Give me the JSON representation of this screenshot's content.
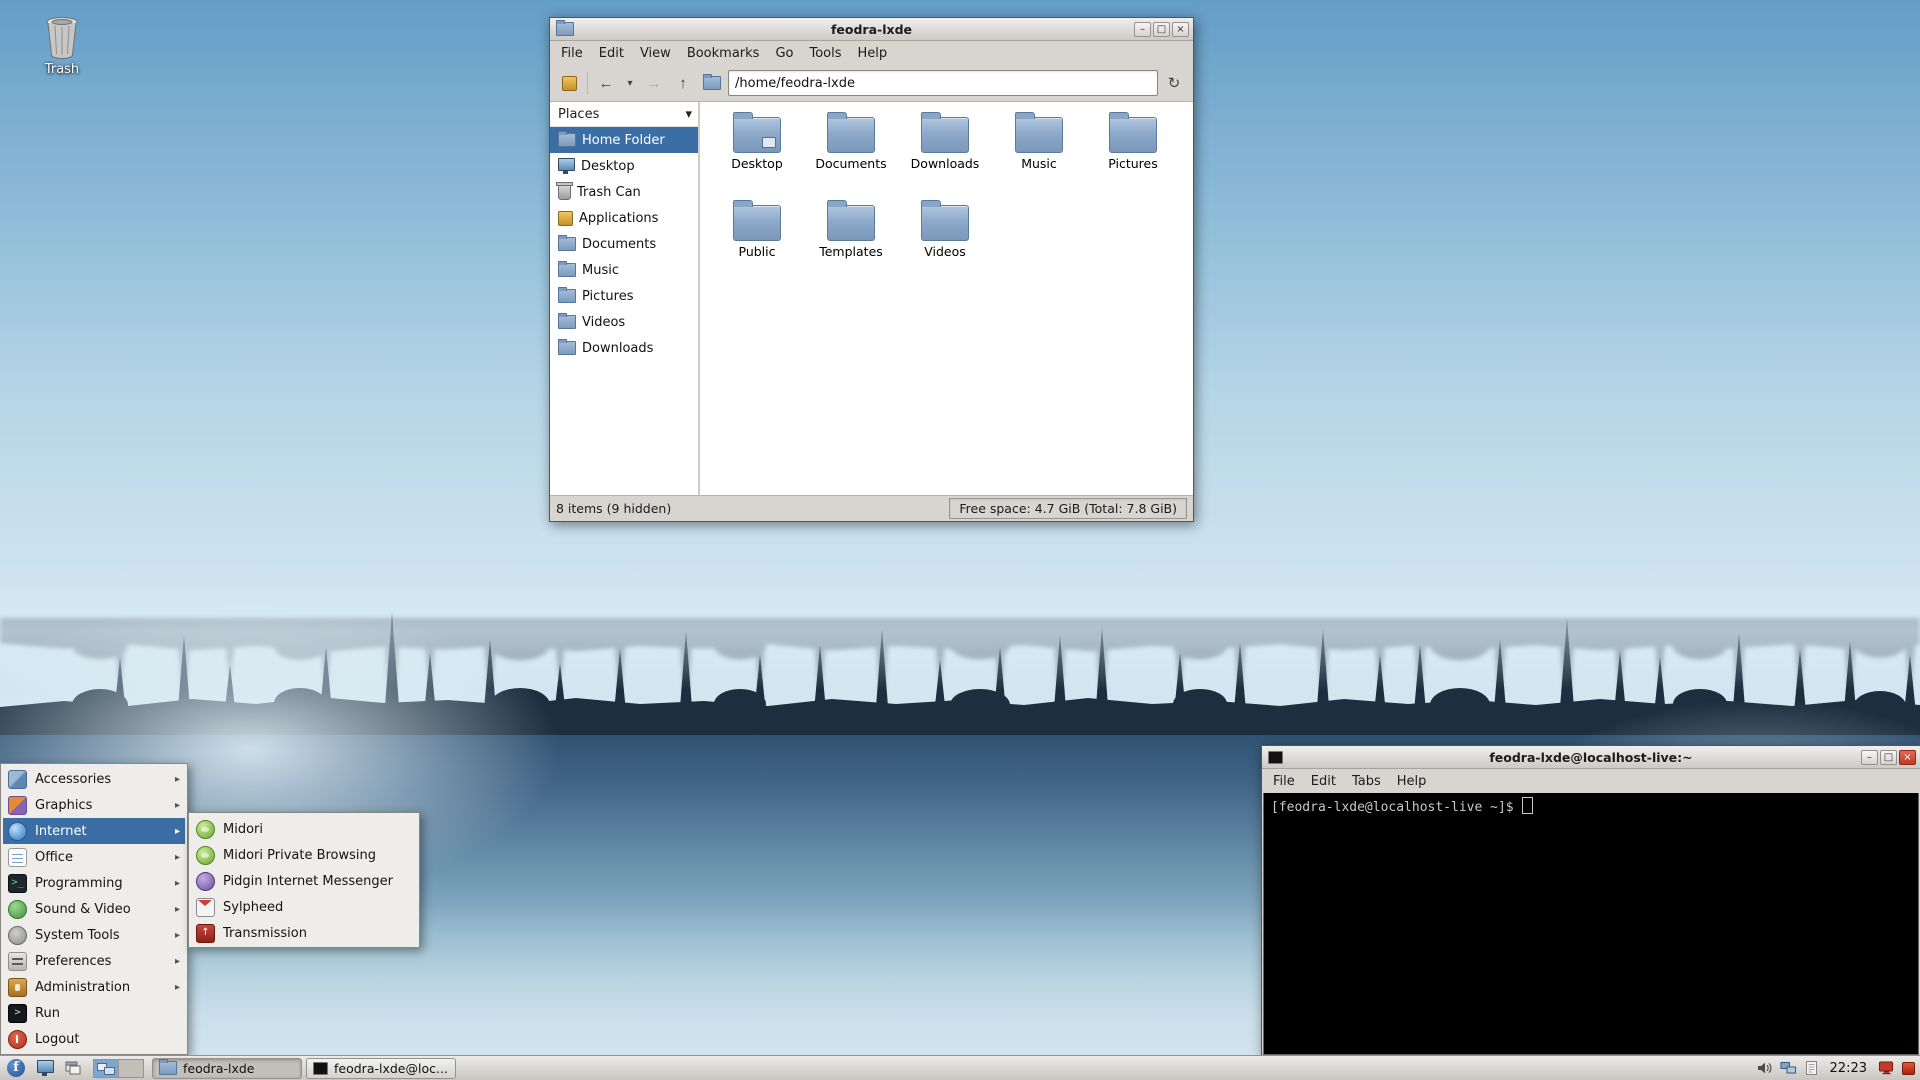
{
  "desktop": {
    "trash_label": "Trash"
  },
  "icons": {
    "back": "←",
    "forward": "→",
    "up": "↑",
    "dropdown": "▾",
    "go": "↻",
    "places_chevron": "▾",
    "submenu_arrow": "▸",
    "minimize": "–",
    "maximize": "□",
    "close": "×",
    "programming_glyph": ">_",
    "run_glyph": ">",
    "transmission_glyph": "↑"
  },
  "file_manager": {
    "title": "feodra-lxde",
    "menubar": [
      "File",
      "Edit",
      "View",
      "Bookmarks",
      "Go",
      "Tools",
      "Help"
    ],
    "path": "/home/feodra-lxde",
    "places_header": "Places",
    "places": [
      {
        "label": "Home Folder",
        "icon": "home-folder",
        "selected": true
      },
      {
        "label": "Desktop",
        "icon": "desktop"
      },
      {
        "label": "Trash Can",
        "icon": "trash"
      },
      {
        "label": "Applications",
        "icon": "applications"
      },
      {
        "label": "Documents",
        "icon": "folder"
      },
      {
        "label": "Music",
        "icon": "folder"
      },
      {
        "label": "Pictures",
        "icon": "folder"
      },
      {
        "label": "Videos",
        "icon": "folder"
      },
      {
        "label": "Downloads",
        "icon": "folder"
      }
    ],
    "folders": [
      "Desktop",
      "Documents",
      "Downloads",
      "Music",
      "Pictures",
      "Public",
      "Templates",
      "Videos"
    ],
    "status_items": "8 items (9 hidden)",
    "status_free": "Free space: 4.7 GiB (Total: 7.8 GiB)"
  },
  "terminal": {
    "title": "feodra-lxde@localhost-live:~",
    "menubar": [
      "File",
      "Edit",
      "Tabs",
      "Help"
    ],
    "prompt": "[feodra-lxde@localhost-live ~]$"
  },
  "start_menu": {
    "items": [
      {
        "label": "Accessories",
        "icon": "accessories",
        "submenu": true
      },
      {
        "label": "Graphics",
        "icon": "graphics",
        "submenu": true
      },
      {
        "label": "Internet",
        "icon": "internet",
        "submenu": true,
        "highlighted": true
      },
      {
        "label": "Office",
        "icon": "office",
        "submenu": true
      },
      {
        "label": "Programming",
        "icon": "programming",
        "submenu": true
      },
      {
        "label": "Sound & Video",
        "icon": "sound",
        "submenu": true
      },
      {
        "label": "System Tools",
        "icon": "system",
        "submenu": true
      },
      {
        "label": "Preferences",
        "icon": "preferences",
        "submenu": true
      },
      {
        "label": "Administration",
        "icon": "administration",
        "submenu": true
      },
      {
        "label": "Run",
        "icon": "run"
      },
      {
        "label": "Logout",
        "icon": "logout"
      }
    ],
    "submenu": [
      {
        "label": "Midori",
        "icon": "midori"
      },
      {
        "label": "Midori Private Browsing",
        "icon": "midori"
      },
      {
        "label": "Pidgin Internet Messenger",
        "icon": "pidgin"
      },
      {
        "label": "Sylpheed",
        "icon": "sylpheed"
      },
      {
        "label": "Transmission",
        "icon": "transmission"
      }
    ]
  },
  "taskbar": {
    "task1": "feodra-lxde",
    "task2": "feodra-lxde@loc...",
    "clock": "22:23"
  },
  "colors": {
    "selection": "#3b6ea5",
    "window_bg": "#d8d4d0",
    "terminal_bg": "#000000"
  }
}
